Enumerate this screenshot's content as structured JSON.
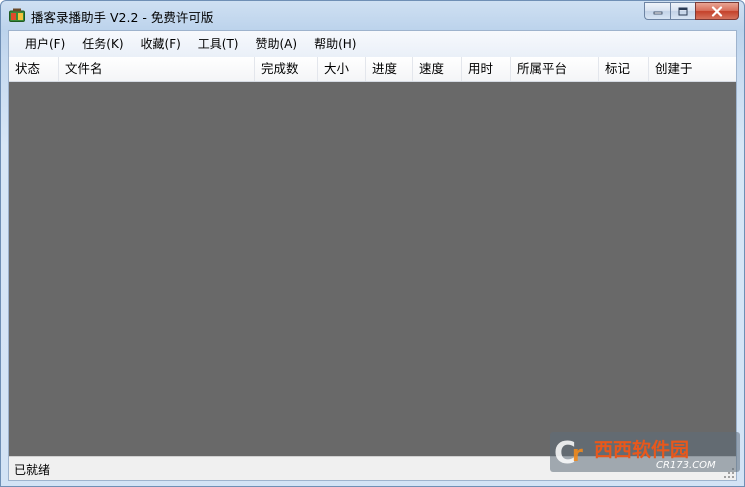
{
  "window": {
    "title": "播客录播助手 V2.2 - 免费许可版",
    "icon": "app-logo-icon",
    "frame_color": "#c9dcf1",
    "close_color": "#c7432d"
  },
  "menu": {
    "items": [
      {
        "label": "用户(F)"
      },
      {
        "label": "任务(K)"
      },
      {
        "label": "收藏(F)"
      },
      {
        "label": "工具(T)"
      },
      {
        "label": "赞助(A)"
      },
      {
        "label": "帮助(H)"
      }
    ]
  },
  "table": {
    "columns": [
      {
        "label": "状态"
      },
      {
        "label": "文件名"
      },
      {
        "label": "完成数"
      },
      {
        "label": "大小"
      },
      {
        "label": "进度"
      },
      {
        "label": "速度"
      },
      {
        "label": "用时"
      },
      {
        "label": "所属平台"
      },
      {
        "label": "标记"
      },
      {
        "label": "创建于"
      }
    ],
    "rows": [],
    "body_color": "#696969"
  },
  "status": {
    "text": "已就绪"
  },
  "watermark": {
    "text": "西西软件园",
    "sub": "CR173.COM"
  }
}
